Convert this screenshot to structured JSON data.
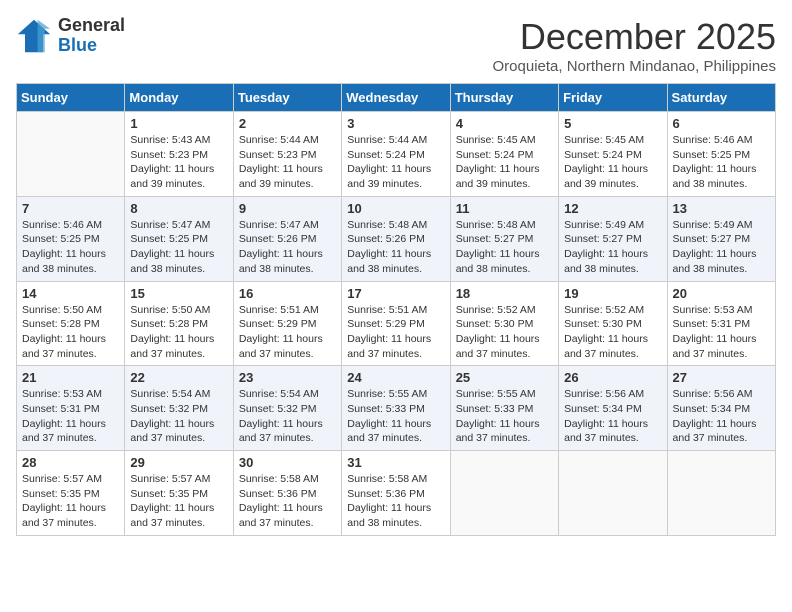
{
  "header": {
    "logo_general": "General",
    "logo_blue": "Blue",
    "month_title": "December 2025",
    "subtitle": "Oroquieta, Northern Mindanao, Philippines"
  },
  "days_of_week": [
    "Sunday",
    "Monday",
    "Tuesday",
    "Wednesday",
    "Thursday",
    "Friday",
    "Saturday"
  ],
  "weeks": [
    [
      {
        "day": "",
        "info": ""
      },
      {
        "day": "1",
        "info": "Sunrise: 5:43 AM\nSunset: 5:23 PM\nDaylight: 11 hours and 39 minutes."
      },
      {
        "day": "2",
        "info": "Sunrise: 5:44 AM\nSunset: 5:23 PM\nDaylight: 11 hours and 39 minutes."
      },
      {
        "day": "3",
        "info": "Sunrise: 5:44 AM\nSunset: 5:24 PM\nDaylight: 11 hours and 39 minutes."
      },
      {
        "day": "4",
        "info": "Sunrise: 5:45 AM\nSunset: 5:24 PM\nDaylight: 11 hours and 39 minutes."
      },
      {
        "day": "5",
        "info": "Sunrise: 5:45 AM\nSunset: 5:24 PM\nDaylight: 11 hours and 39 minutes."
      },
      {
        "day": "6",
        "info": "Sunrise: 5:46 AM\nSunset: 5:25 PM\nDaylight: 11 hours and 38 minutes."
      }
    ],
    [
      {
        "day": "7",
        "info": "Sunrise: 5:46 AM\nSunset: 5:25 PM\nDaylight: 11 hours and 38 minutes."
      },
      {
        "day": "8",
        "info": "Sunrise: 5:47 AM\nSunset: 5:25 PM\nDaylight: 11 hours and 38 minutes."
      },
      {
        "day": "9",
        "info": "Sunrise: 5:47 AM\nSunset: 5:26 PM\nDaylight: 11 hours and 38 minutes."
      },
      {
        "day": "10",
        "info": "Sunrise: 5:48 AM\nSunset: 5:26 PM\nDaylight: 11 hours and 38 minutes."
      },
      {
        "day": "11",
        "info": "Sunrise: 5:48 AM\nSunset: 5:27 PM\nDaylight: 11 hours and 38 minutes."
      },
      {
        "day": "12",
        "info": "Sunrise: 5:49 AM\nSunset: 5:27 PM\nDaylight: 11 hours and 38 minutes."
      },
      {
        "day": "13",
        "info": "Sunrise: 5:49 AM\nSunset: 5:27 PM\nDaylight: 11 hours and 38 minutes."
      }
    ],
    [
      {
        "day": "14",
        "info": "Sunrise: 5:50 AM\nSunset: 5:28 PM\nDaylight: 11 hours and 37 minutes."
      },
      {
        "day": "15",
        "info": "Sunrise: 5:50 AM\nSunset: 5:28 PM\nDaylight: 11 hours and 37 minutes."
      },
      {
        "day": "16",
        "info": "Sunrise: 5:51 AM\nSunset: 5:29 PM\nDaylight: 11 hours and 37 minutes."
      },
      {
        "day": "17",
        "info": "Sunrise: 5:51 AM\nSunset: 5:29 PM\nDaylight: 11 hours and 37 minutes."
      },
      {
        "day": "18",
        "info": "Sunrise: 5:52 AM\nSunset: 5:30 PM\nDaylight: 11 hours and 37 minutes."
      },
      {
        "day": "19",
        "info": "Sunrise: 5:52 AM\nSunset: 5:30 PM\nDaylight: 11 hours and 37 minutes."
      },
      {
        "day": "20",
        "info": "Sunrise: 5:53 AM\nSunset: 5:31 PM\nDaylight: 11 hours and 37 minutes."
      }
    ],
    [
      {
        "day": "21",
        "info": "Sunrise: 5:53 AM\nSunset: 5:31 PM\nDaylight: 11 hours and 37 minutes."
      },
      {
        "day": "22",
        "info": "Sunrise: 5:54 AM\nSunset: 5:32 PM\nDaylight: 11 hours and 37 minutes."
      },
      {
        "day": "23",
        "info": "Sunrise: 5:54 AM\nSunset: 5:32 PM\nDaylight: 11 hours and 37 minutes."
      },
      {
        "day": "24",
        "info": "Sunrise: 5:55 AM\nSunset: 5:33 PM\nDaylight: 11 hours and 37 minutes."
      },
      {
        "day": "25",
        "info": "Sunrise: 5:55 AM\nSunset: 5:33 PM\nDaylight: 11 hours and 37 minutes."
      },
      {
        "day": "26",
        "info": "Sunrise: 5:56 AM\nSunset: 5:34 PM\nDaylight: 11 hours and 37 minutes."
      },
      {
        "day": "27",
        "info": "Sunrise: 5:56 AM\nSunset: 5:34 PM\nDaylight: 11 hours and 37 minutes."
      }
    ],
    [
      {
        "day": "28",
        "info": "Sunrise: 5:57 AM\nSunset: 5:35 PM\nDaylight: 11 hours and 37 minutes."
      },
      {
        "day": "29",
        "info": "Sunrise: 5:57 AM\nSunset: 5:35 PM\nDaylight: 11 hours and 37 minutes."
      },
      {
        "day": "30",
        "info": "Sunrise: 5:58 AM\nSunset: 5:36 PM\nDaylight: 11 hours and 37 minutes."
      },
      {
        "day": "31",
        "info": "Sunrise: 5:58 AM\nSunset: 5:36 PM\nDaylight: 11 hours and 38 minutes."
      },
      {
        "day": "",
        "info": ""
      },
      {
        "day": "",
        "info": ""
      },
      {
        "day": "",
        "info": ""
      }
    ]
  ]
}
